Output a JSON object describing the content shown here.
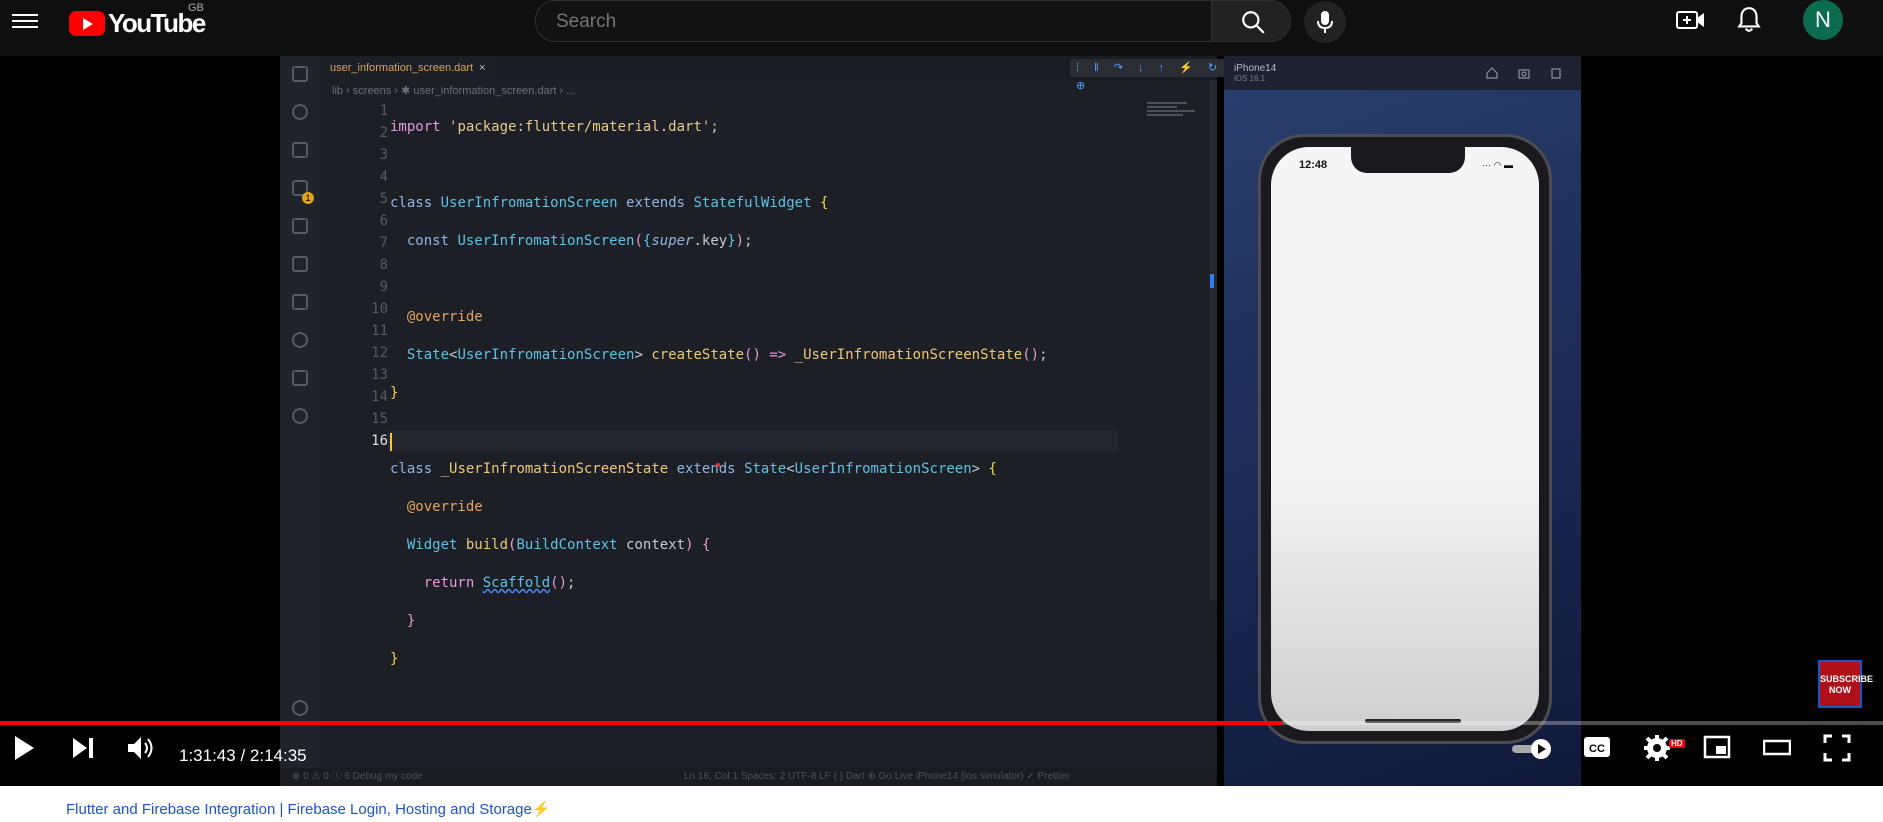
{
  "header": {
    "logo_text": "YouTube",
    "country_code": "GB",
    "search_placeholder": "Search",
    "avatar_letter": "N",
    "icons": [
      "menu-icon",
      "search-icon",
      "microphone-icon",
      "create-video-icon",
      "notifications-icon"
    ]
  },
  "vscode": {
    "tab_label": "user_information_screen.dart",
    "breadcrumb": "lib › screens › ✱ user_information_screen.dart › ...",
    "debug_badge_count": "1",
    "line_numbers": [
      "1",
      "2",
      "3",
      "4",
      "5",
      "6",
      "7",
      "8",
      "9",
      "10",
      "11",
      "12",
      "13",
      "14",
      "15",
      "16"
    ],
    "status_left": "⊗ 0 ⚠ 0 ⓘ 6     Debug my code",
    "status_right": "Ln 16, Col 1   Spaces: 2   UTF-8   LF   { } Dart   ⊕ Go Live   iPhone14 (ios simulator)   ✓ Prettier"
  },
  "simulator": {
    "device_name": "iPhone14",
    "device_os": "iOS 16.1",
    "clock": "12:48"
  },
  "player": {
    "current_time": "1:31:43",
    "total_time": "2:14:35",
    "time_display": "1:31:43 / 2:14:35",
    "progress_fraction": 0.681,
    "quality_badge": "HD",
    "subscribe_overlay": "SUBSCRIBE NOW",
    "accent_color": "#ff0000"
  },
  "video": {
    "title": "Flutter and Firebase Integration | Firebase Login, Hosting and Storage⚡"
  }
}
